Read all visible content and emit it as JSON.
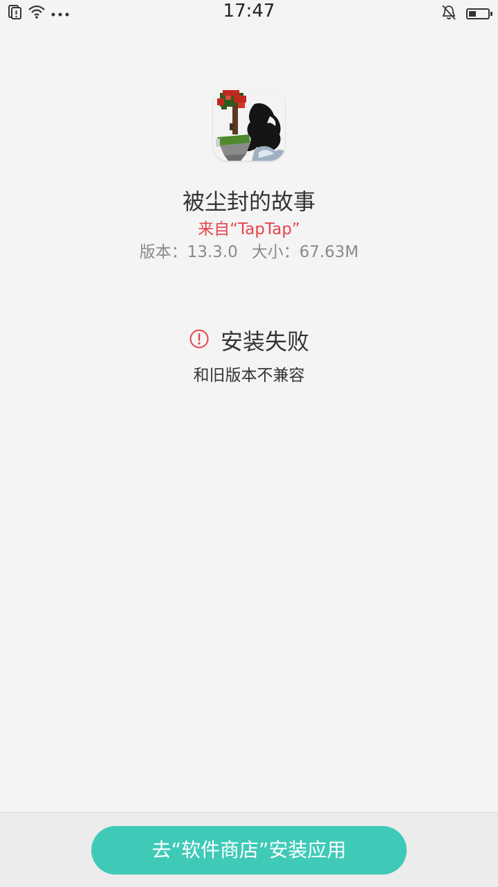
{
  "status_bar": {
    "time": "17:47",
    "battery_level": 0.4,
    "left_icons": [
      "sim-alert-icon",
      "wifi-icon",
      "more-dots-icon"
    ],
    "right_icons": [
      "bell-muted-icon",
      "battery-icon"
    ]
  },
  "app": {
    "name": "被尘封的故事",
    "source": "来自“TapTap”",
    "version_label": "版本：13.3.0",
    "size_label": "大小：67.63M",
    "icon": "app-icon"
  },
  "result": {
    "title": "安装失败",
    "reason": "和旧版本不兼容",
    "status_color": "#e5454b"
  },
  "actions": {
    "store_button_label": "去“软件商店”安装应用",
    "accent_color": "#3fcab8"
  }
}
